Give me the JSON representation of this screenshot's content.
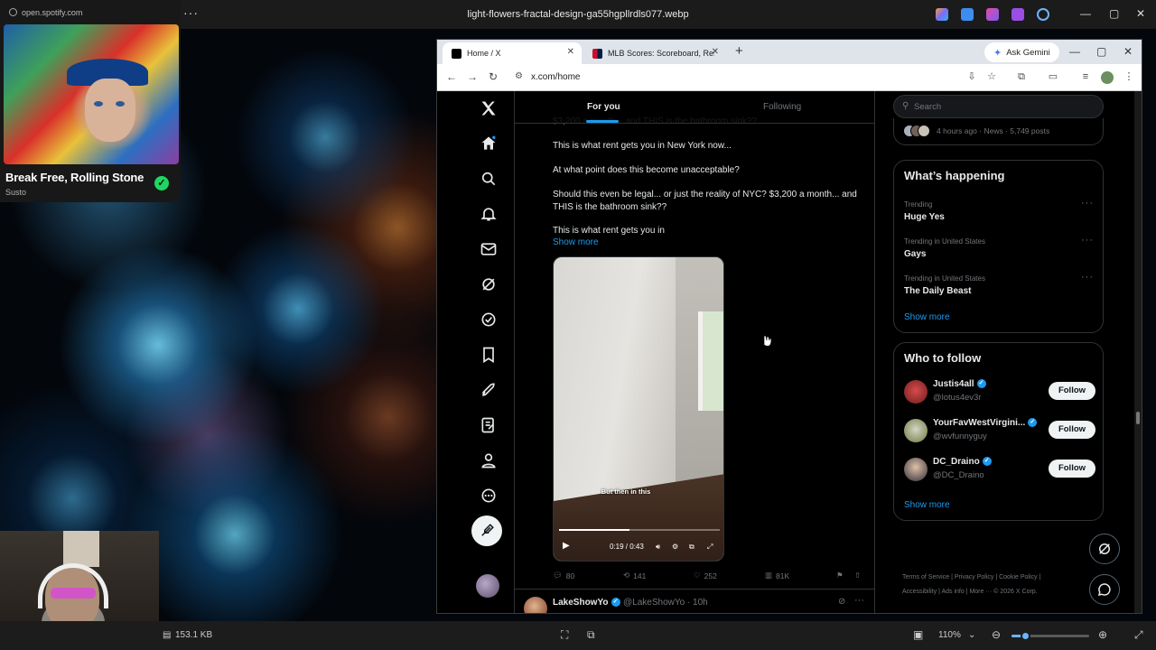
{
  "viewer": {
    "title": "light-flowers-fractal-design-ga55hgpllrdls077.webp",
    "file_size": "153.1 KB",
    "zoom": "110%",
    "zoom_fraction": 0.18
  },
  "spotify": {
    "url": "open.spotify.com",
    "track": "Break Free, Rolling Stone",
    "artist": "Susto"
  },
  "browser": {
    "tabs": [
      {
        "label": "Home / X",
        "active": true
      },
      {
        "label": "MLB Scores: Scoreboard, Result",
        "active": false
      }
    ],
    "gemini_label": "Ask Gemini",
    "url": "x.com/home"
  },
  "x": {
    "feed_tabs": [
      "For you",
      "Following"
    ],
    "post": {
      "lines": [
        "$3,200 a month... and THIS is the bathroom sink??",
        "This is what rent gets you in New York now...",
        "At what point does this become unacceptable?",
        "Should this even be legal... or just the reality of NYC? $3,200 a month... and THIS is the bathroom sink??",
        "This is what rent gets you in"
      ],
      "show_more": "Show more",
      "video": {
        "caption": "But then in this",
        "time": "0:19 / 0:43",
        "progress": 0.44
      },
      "actions": {
        "replies": "80",
        "reposts": "141",
        "likes": "252",
        "views": "81K"
      }
    },
    "next_post": {
      "name": "LakeShowYo",
      "handle": "@LakeShowYo · 10h"
    },
    "sidebar": {
      "search_placeholder": "Search",
      "top_trend_meta": "4 hours ago · News · 5,749 posts",
      "whats_happening": {
        "title": "What’s happening",
        "trends": [
          {
            "context": "Trending",
            "name": "Huge Yes"
          },
          {
            "context": "Trending in United States",
            "name": "Gays"
          },
          {
            "context": "Trending in United States",
            "name": "The Daily Beast"
          }
        ],
        "show_more": "Show more"
      },
      "who_to_follow": {
        "title": "Who to follow",
        "accounts": [
          {
            "name": "Justis4all",
            "handle": "@lotus4ev3r"
          },
          {
            "name": "YourFavWestVirgini...",
            "handle": "@wvfunnyguy"
          },
          {
            "name": "DC_Draino",
            "handle": "@DC_Draino"
          }
        ],
        "follow_label": "Follow",
        "show_more": "Show more"
      },
      "footer": {
        "line1": "Terms of Service  |  Privacy Policy  |  Cookie Policy  |",
        "line2": "Accessibility  |  Ads info  |  More ···  © 2026 X Corp."
      }
    }
  },
  "colors": {
    "x_blue": "#1d9bf0",
    "spotify_green": "#1ed760"
  }
}
